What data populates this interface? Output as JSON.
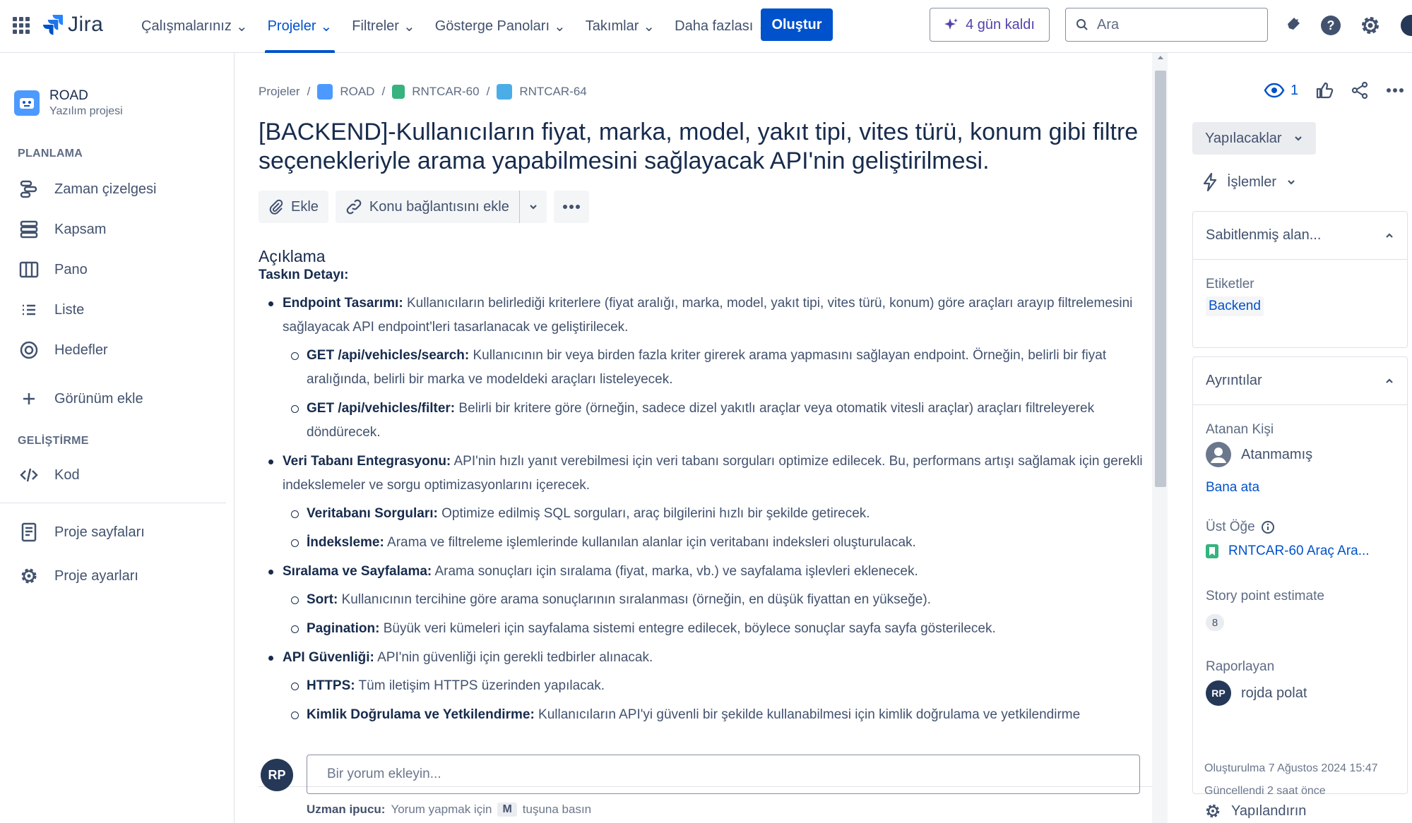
{
  "topnav": {
    "logo_text": "Jira",
    "menu": [
      {
        "label": "Çalışmalarınız"
      },
      {
        "label": "Projeler"
      },
      {
        "label": "Filtreler"
      },
      {
        "label": "Gösterge Panoları"
      },
      {
        "label": "Takımlar"
      },
      {
        "label": "Daha fazlası"
      }
    ],
    "create_label": "Oluştur",
    "trial_label": "4 gün kaldı",
    "search_placeholder": "Ara",
    "accent": "#0052cc"
  },
  "sidebar": {
    "project_name": "ROAD",
    "project_type": "Yazılım projesi",
    "planning_heading": "PLANLAMA",
    "planning_items": [
      {
        "label": "Zaman çizelgesi",
        "icon": "timeline-icon"
      },
      {
        "label": "Kapsam",
        "icon": "backlog-icon"
      },
      {
        "label": "Pano",
        "icon": "board-icon"
      },
      {
        "label": "Liste",
        "icon": "list-icon"
      },
      {
        "label": "Hedefler",
        "icon": "goals-icon"
      }
    ],
    "add_view_label": "Görünüm ekle",
    "dev_heading": "GELİŞTİRME",
    "code_label": "Kod",
    "project_pages_label": "Proje sayfaları",
    "project_settings_label": "Proje ayarları"
  },
  "breadcrumb": {
    "projects": "Projeler",
    "project": "ROAD",
    "parent": "RNTCAR-60",
    "issue": "RNTCAR-64"
  },
  "issue": {
    "title": "[BACKEND]-Kullanıcıların fiyat, marka, model, yakıt tipi, vites türü, konum gibi filtre seçenekleriyle arama yapabilmesini sağlayacak API'nin geliştirilmesi.",
    "attach_label": "Ekle",
    "link_label": "Konu bağlantısını ekle",
    "description_label": "Açıklama",
    "task_heading": "Taskın Detayı:",
    "bullets": [
      {
        "key": "Endpoint Tasarımı:",
        "text": " Kullanıcıların belirlediği kriterlere (fiyat aralığı, marka, model, yakıt tipi, vites türü, konum) göre araçları arayıp filtrelemesini sağlayacak API endpoint'leri tasarlanacak ve geliştirilecek.",
        "sub": [
          {
            "key": "GET /api/vehicles/search:",
            "text": " Kullanıcının bir veya birden fazla kriter girerek arama yapmasını sağlayan endpoint. Örneğin, belirli bir fiyat aralığında, belirli bir marka ve modeldeki araçları listeleyecek."
          },
          {
            "key": "GET /api/vehicles/filter:",
            "text": " Belirli bir kritere göre (örneğin, sadece dizel yakıtlı araçlar veya otomatik vitesli araçlar) araçları filtreleyerek döndürecek."
          }
        ]
      },
      {
        "key": "Veri Tabanı Entegrasyonu:",
        "text": " API'nin hızlı yanıt verebilmesi için veri tabanı sorguları optimize edilecek. Bu, performans artışı sağlamak için gerekli indekslemeler ve sorgu optimizasyonlarını içerecek.",
        "sub": [
          {
            "key": "Veritabanı Sorguları:",
            "text": " Optimize edilmiş SQL sorguları, araç bilgilerini hızlı bir şekilde getirecek."
          },
          {
            "key": "İndeksleme:",
            "text": " Arama ve filtreleme işlemlerinde kullanılan alanlar için veritabanı indeksleri oluşturulacak."
          }
        ]
      },
      {
        "key": "Sıralama ve Sayfalama:",
        "text": " Arama sonuçları için sıralama (fiyat, marka, vb.) ve sayfalama işlevleri eklenecek.",
        "sub": [
          {
            "key": "Sort:",
            "text": " Kullanıcının tercihine göre arama sonuçlarının sıralanması (örneğin, en düşük fiyattan en yükseğe)."
          },
          {
            "key": "Pagination:",
            "text": " Büyük veri kümeleri için sayfalama sistemi entegre edilecek, böylece sonuçlar sayfa sayfa gösterilecek."
          }
        ]
      },
      {
        "key": "API Güvenliği:",
        "text": " API'nin güvenliği için gerekli tedbirler alınacak.",
        "sub": [
          {
            "key": "HTTPS:",
            "text": " Tüm iletişim HTTPS üzerinden yapılacak."
          },
          {
            "key": "Kimlik Doğrulama ve Yetkilendirme:",
            "text": " Kullanıcıların API'yi güvenli bir şekilde kullanabilmesi için kimlik doğrulama ve yetkilendirme"
          }
        ]
      }
    ],
    "comment_avatar": "RP",
    "comment_placeholder": "Bir yorum ekleyin...",
    "tip_label": "Uzman ipucu:",
    "tip_text_before": "Yorum yapmak için",
    "tip_key": "M",
    "tip_text_after": "tuşuna basın"
  },
  "rightpanel": {
    "watchers": "1",
    "status": "Yapılacaklar",
    "actions_label": "İşlemler",
    "pinned_heading": "Sabitlenmiş alan...",
    "labels_label": "Etiketler",
    "label_value": "Backend",
    "details_heading": "Ayrıntılar",
    "assignee_label": "Atanan Kişi",
    "assignee_value": "Atanmamış",
    "assign_me": "Bana ata",
    "parent_label": "Üst Öğe",
    "parent_value": "RNTCAR-60 Araç Ara...",
    "story_points_label": "Story point estimate",
    "story_points_value": "8",
    "reporter_label": "Raporlayan",
    "reporter_initials": "RP",
    "reporter_name": "rojda polat",
    "created": "Oluşturulma 7 Ağustos 2024 15:47",
    "updated": "Güncellendi 2 saat önce",
    "configure_label": "Yapılandırın"
  }
}
